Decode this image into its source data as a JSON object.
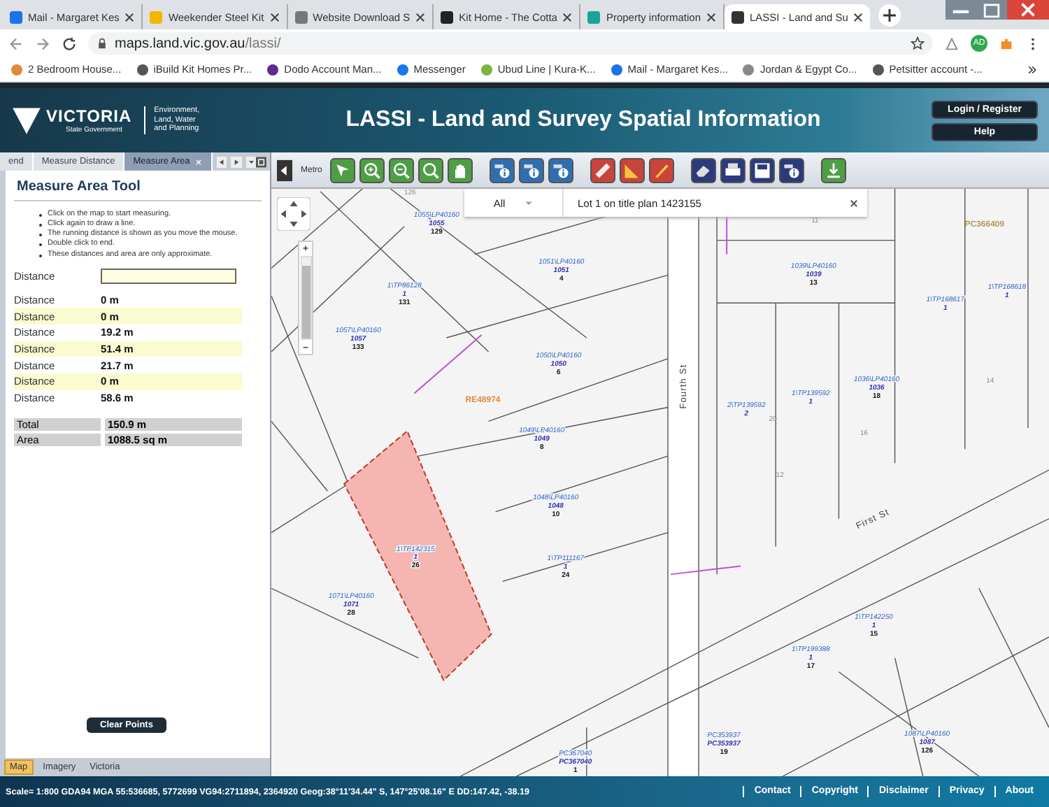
{
  "browser": {
    "tabs": [
      {
        "title": "Mail - Margaret Kes",
        "selected": false
      },
      {
        "title": "Weekender Steel Kit",
        "selected": false
      },
      {
        "title": "Website Download S",
        "selected": false
      },
      {
        "title": "Kit Home - The Cotta",
        "selected": false
      },
      {
        "title": "Property information",
        "selected": false
      },
      {
        "title": "LASSI - Land and Su",
        "selected": true
      }
    ],
    "address": {
      "host": "maps.land.vic.gov.au",
      "path": "/lassi/"
    },
    "profile_initials": "AD",
    "bookmarks": [
      {
        "label": "2 Bedroom House..."
      },
      {
        "label": "iBuild Kit Homes Pr..."
      },
      {
        "label": "Dodo Account Man..."
      },
      {
        "label": "Messenger"
      },
      {
        "label": "Ubud Line | Kura-K..."
      },
      {
        "label": "Mail - Margaret Kes..."
      },
      {
        "label": "Jordan & Egypt Co..."
      },
      {
        "label": "Petsitter account -..."
      }
    ]
  },
  "header": {
    "logo": {
      "name": "VICTORIA",
      "sub": "State Government"
    },
    "department": [
      "Environment,",
      "Land, Water",
      "and Planning"
    ],
    "title": "LASSI - Land and Survey Spatial Information",
    "buttons": [
      "Login / Register",
      "Help"
    ]
  },
  "panel": {
    "tabs": [
      {
        "label": "end",
        "selected": false
      },
      {
        "label": "Measure Distance",
        "selected": false
      },
      {
        "label": "Measure Area",
        "selected": true
      }
    ],
    "title": "Measure Area Tool",
    "instructions": [
      "Click on the map to start measuring.",
      "Click again to draw a line.",
      "The running distance is shown as you move the mouse.",
      "Double click to end.",
      "These distances and area are only approximate."
    ],
    "input_label": "Distance",
    "rows": [
      {
        "label": "Distance",
        "value": "0 m",
        "highlighted": false
      },
      {
        "label": "Distance",
        "value": "0 m",
        "highlighted": true
      },
      {
        "label": "Distance",
        "value": "19.2 m",
        "highlighted": false
      },
      {
        "label": "Distance",
        "value": "51.4 m",
        "highlighted": true
      },
      {
        "label": "Distance",
        "value": "21.7 m",
        "highlighted": false
      },
      {
        "label": "Distance",
        "value": "0 m",
        "highlighted": true
      },
      {
        "label": "Distance",
        "value": "58.6 m",
        "highlighted": false
      }
    ],
    "totals": [
      {
        "label": "Total",
        "value": "150.9 m"
      },
      {
        "label": "Area",
        "value": "1088.5 sq m"
      }
    ],
    "clear_button": "Clear Points",
    "bottom_tabs": [
      {
        "label": "Map",
        "selected": true
      },
      {
        "label": "Imagery",
        "selected": false
      },
      {
        "label": "Victoria",
        "selected": false
      }
    ]
  },
  "toolbar": {
    "label": "Metro",
    "buttons": [
      {
        "kind": "select"
      },
      {
        "kind": "zoom-in"
      },
      {
        "kind": "zoom-out"
      },
      {
        "kind": "zoom-area"
      },
      {
        "kind": "pan"
      },
      {
        "kind": "identify"
      },
      {
        "kind": "identify-layers"
      },
      {
        "kind": "label-info"
      },
      {
        "kind": "measure-distance"
      },
      {
        "kind": "measure-area"
      },
      {
        "kind": "draw"
      },
      {
        "kind": "erase"
      },
      {
        "kind": "print"
      },
      {
        "kind": "save"
      },
      {
        "kind": "save-info"
      },
      {
        "kind": "download"
      }
    ]
  },
  "search": {
    "scope": "All",
    "value": "Lot 1 on title plan 1423155"
  },
  "map": {
    "parcels": [
      {
        "lines": [
          "1055\\LP40160",
          "1055",
          "129"
        ]
      },
      {
        "lines": [
          "1\\TP86128",
          "1",
          "131"
        ]
      },
      {
        "lines": [
          "1051\\LP40160",
          "1051",
          "4"
        ]
      },
      {
        "lines": [
          "1057\\LP40160",
          "1057",
          "133"
        ]
      },
      {
        "lines": [
          "1050\\LP40160",
          "1050",
          "6"
        ]
      },
      {
        "lines": [
          "1049\\LP40160",
          "1049",
          "8"
        ]
      },
      {
        "lines": [
          "1048\\LP40160",
          "1048",
          "10"
        ]
      },
      {
        "lines": [
          "1\\TP142315",
          "1",
          "26"
        ]
      },
      {
        "lines": [
          "1\\TP111167",
          "1",
          "24"
        ]
      },
      {
        "lines": [
          "1071\\LP40160",
          "1071",
          "28"
        ]
      },
      {
        "lines": [
          "1039\\LP40160",
          "1039",
          "13"
        ]
      },
      {
        "lines": [
          "2\\TP139592",
          "2"
        ]
      },
      {
        "lines": [
          "1\\TP139592",
          "1"
        ]
      },
      {
        "lines": [
          "1036\\LP40160",
          "1036",
          "18"
        ]
      },
      {
        "lines": [
          "1\\TP168617",
          "1"
        ]
      },
      {
        "lines": [
          "1\\TP168618",
          "1"
        ]
      },
      {
        "lines": [
          "1\\TP199388",
          "1",
          "17"
        ]
      },
      {
        "lines": [
          "1\\TP142250",
          "1",
          "15"
        ]
      },
      {
        "lines": [
          "PC353937",
          "PC353937",
          "19"
        ]
      },
      {
        "lines": [
          "PC367040",
          "PC367040",
          "1"
        ]
      },
      {
        "lines": [
          "1087\\LP40160",
          "1087",
          "126"
        ]
      }
    ],
    "streets": [
      "Fourth St",
      "First St"
    ],
    "annotations": [
      {
        "text": "RE48974",
        "color": "#e08a3c"
      },
      {
        "text": "PC366409",
        "color": "#b09a5a"
      }
    ],
    "lot_numbers": [
      "126",
      "11",
      "14",
      "20",
      "12",
      "16"
    ],
    "zoom_slider": {
      "level": 0.9
    }
  },
  "status": {
    "coordinates": "Scale= 1:800 GDA94 MGA 55:536685, 5772699 VG94:2711894, 2364920 Geog:38°11'34.44\" S, 147°25'08.16\" E DD:147.42, -38.19",
    "links": [
      "Contact",
      "Copyright",
      "Disclaimer",
      "Privacy",
      "About"
    ]
  }
}
